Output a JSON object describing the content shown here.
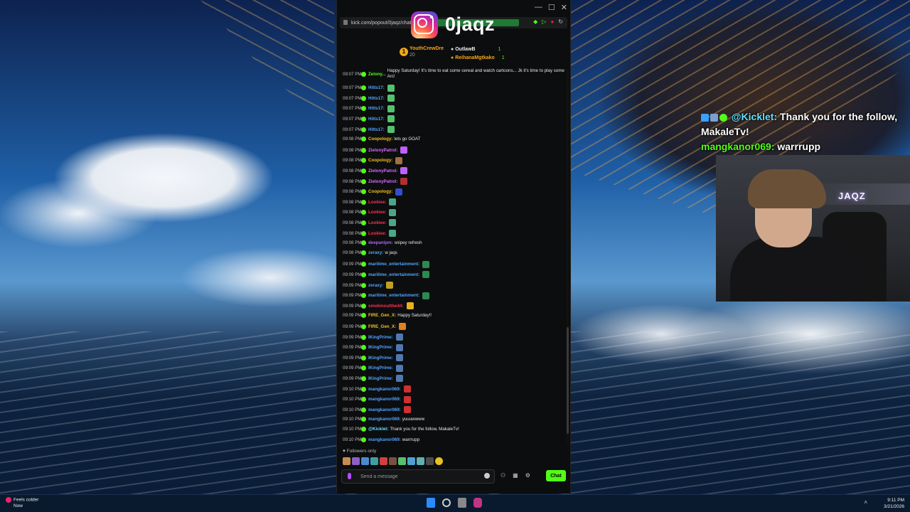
{
  "browser": {
    "url": "kick.com/popout/0jaqz/chat"
  },
  "overlay_brand": {
    "handle": "0jaqz"
  },
  "leaderboard": [
    {
      "rank": "1",
      "name": "YouthCrewDre",
      "sub": "20"
    },
    {
      "name": "OutlawB",
      "count": "1"
    },
    {
      "name": "ReihanaMgtkako",
      "count": "1"
    }
  ],
  "chat": {
    "messages": [
      {
        "time": "09:07 PM",
        "user": "Zelony...",
        "msg": "Happy Saturday! It's time to eat some cereal and watch cartoons... Jk it's time to play some Arc!",
        "color": "#53fc18"
      },
      {
        "time": "09:07 PM",
        "user": "Hitts17:",
        "msg": "",
        "color": "#4fa3ff",
        "emote": "#53c26e"
      },
      {
        "time": "09:07 PM",
        "user": "Hitts17:",
        "msg": "",
        "color": "#4fa3ff",
        "emote": "#53c26e"
      },
      {
        "time": "09:07 PM",
        "user": "Hitts17:",
        "msg": "",
        "color": "#4fa3ff",
        "emote": "#53c26e"
      },
      {
        "time": "09:07 PM",
        "user": "Hitts17:",
        "msg": "",
        "color": "#4fa3ff",
        "emote": "#53c26e"
      },
      {
        "time": "09:07 PM",
        "user": "Hitts17:",
        "msg": "",
        "color": "#4fa3ff",
        "emote": "#53c26e"
      },
      {
        "time": "09:08 PM",
        "user": "Coopology:",
        "msg": "lets go GOAT",
        "color": "#f0c020"
      },
      {
        "time": "09:08 PM",
        "user": "ZielonyPatrol:",
        "msg": "",
        "color": "#d66cff",
        "emote": "#c060ff"
      },
      {
        "time": "09:08 PM",
        "user": "Coopology:",
        "msg": "",
        "color": "#f0c020",
        "emote": "#a07040"
      },
      {
        "time": "09:08 PM",
        "user": "ZielonyPatrol:",
        "msg": "",
        "color": "#d66cff",
        "emote": "#c060ff"
      },
      {
        "time": "09:08 PM",
        "user": "ZielonyPatrol:",
        "msg": "",
        "color": "#d66cff",
        "emote": "#b03030"
      },
      {
        "time": "09:08 PM",
        "user": "Coopology:",
        "msg": "",
        "color": "#f0c020",
        "emote": "#3050d0"
      },
      {
        "time": "09:08 PM",
        "user": "Lookiee:",
        "msg": "",
        "color": "#ff3050",
        "emote": "#4aa888"
      },
      {
        "time": "09:08 PM",
        "user": "Lookiee:",
        "msg": "",
        "color": "#ff3050",
        "emote": "#4aa888"
      },
      {
        "time": "09:08 PM",
        "user": "Lookiee:",
        "msg": "",
        "color": "#ff3050",
        "emote": "#4aa888"
      },
      {
        "time": "09:08 PM",
        "user": "Lookiee:",
        "msg": "",
        "color": "#ff3050",
        "emote": "#4aa888"
      },
      {
        "time": "09:08 PM",
        "user": "deepanipm:",
        "msg": "snipey refresh",
        "color": "#b060ff"
      },
      {
        "time": "09:08 PM",
        "user": "zeraxy:",
        "msg": "w jaqs",
        "color": "#4fa3ff"
      },
      {
        "time": "09:09 PM",
        "user": "maritime_entertainment:",
        "msg": "",
        "color": "#4fa3ff",
        "emote": "#2c8a50"
      },
      {
        "time": "09:09 PM",
        "user": "maritime_entertainment:",
        "msg": "",
        "color": "#4fa3ff",
        "emote": "#2c8a50"
      },
      {
        "time": "09:09 PM",
        "user": "zeraxy:",
        "msg": "",
        "color": "#4fa3ff",
        "emote": "#c0a020"
      },
      {
        "time": "09:09 PM",
        "user": "maritime_entertainment:",
        "msg": "",
        "color": "#4fa3ff",
        "emote": "#2c8a50"
      },
      {
        "time": "09:09 PM",
        "user": "smokinoutthe44:",
        "msg": "",
        "color": "#ff3050",
        "emote": "#e8b020"
      },
      {
        "time": "09:09 PM",
        "user": "FIRE_Gen_X:",
        "msg": "Happy Saturday!!",
        "color": "#f0c020"
      },
      {
        "time": "09:09 PM",
        "user": "FIRE_Gen_X:",
        "msg": "",
        "color": "#f0c020",
        "emote": "#e08020"
      },
      {
        "time": "09:09 PM",
        "user": "IKingPrime:",
        "msg": "",
        "color": "#4fa3ff",
        "emote": "#5078b0"
      },
      {
        "time": "09:09 PM",
        "user": "IKingPrime:",
        "msg": "",
        "color": "#4fa3ff",
        "emote": "#5078b0"
      },
      {
        "time": "09:09 PM",
        "user": "IKingPrime:",
        "msg": "",
        "color": "#4fa3ff",
        "emote": "#5078b0"
      },
      {
        "time": "09:09 PM",
        "user": "IKingPrime:",
        "msg": "",
        "color": "#4fa3ff",
        "emote": "#5078b0"
      },
      {
        "time": "09:09 PM",
        "user": "IKingPrime:",
        "msg": "",
        "color": "#4fa3ff",
        "emote": "#5078b0"
      },
      {
        "time": "09:10 PM",
        "user": "mangkanor069:",
        "msg": "",
        "color": "#4fa3ff",
        "emote": "#d03030"
      },
      {
        "time": "09:10 PM",
        "user": "mangkanor069:",
        "msg": "",
        "color": "#4fa3ff",
        "emote": "#d03030"
      },
      {
        "time": "09:10 PM",
        "user": "mangkanor069:",
        "msg": "",
        "color": "#4fa3ff",
        "emote": "#d03030"
      },
      {
        "time": "09:10 PM",
        "user": "mangkanor069:",
        "msg": "yuuuwwww",
        "color": "#4fa3ff"
      },
      {
        "time": "09:10 PM",
        "user": "@Kicklet:",
        "msg": "Thank you for the follow, MakaleTv!",
        "color": "#60e0ff"
      },
      {
        "time": "09:10 PM",
        "user": "mangkanor069:",
        "msg": "warrrupp",
        "color": "#4fa3ff"
      }
    ],
    "followers_only": "Followers only",
    "input_placeholder": "Send a message",
    "send_label": "Chat"
  },
  "overlay": {
    "bot": "@Kicklet:",
    "line1": "Thank you for the follow,",
    "line2": "MakaleTv!",
    "user2": "mangkanor069:",
    "msg2": "warrrupp"
  },
  "webcam": {
    "sign": "JAQZ"
  },
  "taskbar": {
    "weather_title": "Feels colder",
    "weather_sub": "Now",
    "time": "9:11 PM",
    "date": "3/21/2026"
  },
  "colors": {
    "kick_green": "#53fc18",
    "accent_orange": "#f0a818"
  }
}
